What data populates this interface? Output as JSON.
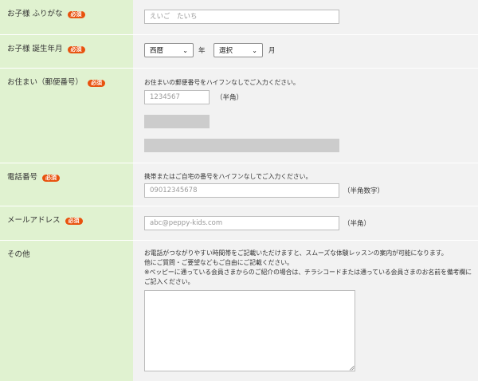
{
  "colors": {
    "label_bg": "#e0f2d0",
    "value_bg": "#f2f2f2",
    "required_badge": "#e8520e"
  },
  "required_label": "必須",
  "kana": {
    "label": "お子様 ふりがな",
    "placeholder": "えいご　たいち"
  },
  "birth": {
    "label": "お子様 誕生年月",
    "era_value": "西暦",
    "year_unit": "年",
    "month_value": "選択",
    "month_unit": "月"
  },
  "address": {
    "label": "お住まい（郵便番号）",
    "instruction": "お住まいの郵便番号をハイフンなしでご入力ください。",
    "placeholder": "1234567",
    "unit": "（半角）"
  },
  "phone": {
    "label": "電話番号",
    "instruction": "携帯またはご自宅の番号をハイフンなしでご入力ください。",
    "placeholder": "09012345678",
    "unit": "（半角数字）"
  },
  "email": {
    "label": "メールアドレス",
    "placeholder": "abc@peppy-kids.com",
    "unit": "（半角）"
  },
  "other": {
    "label": "その他",
    "note_1": "お電話がつながりやすい時間帯をご記載いただけますと、スムーズな体験レッスンの案内が可能になります。",
    "note_2": "他にご質問・ご要望などもご自由にご記載ください。",
    "note_3": "※ペッピーに通っている会員さまからのご紹介の場合は、チラシコードまたは通っている会員さまのお名前を備考欄に",
    "note_4": "ご記入ください。"
  }
}
